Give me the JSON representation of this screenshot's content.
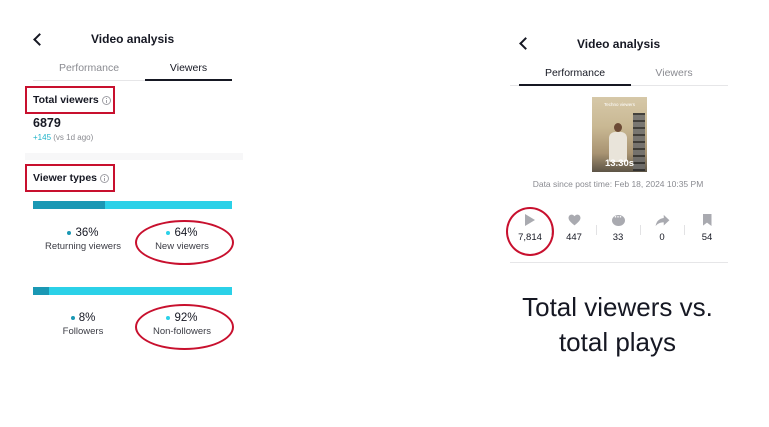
{
  "left": {
    "header": {
      "title": "Video analysis"
    },
    "tabs": [
      {
        "label": "Performance",
        "active": false
      },
      {
        "label": "Viewers",
        "active": true
      }
    ],
    "total_viewers": {
      "label": "Total viewers",
      "value": "6879",
      "delta": "+145",
      "delta_suffix": "(vs 1d ago)"
    },
    "viewer_types": {
      "label": "Viewer types",
      "split1": {
        "left_pct": "36%",
        "left_label": "Returning viewers",
        "right_pct": "64%",
        "right_label": "New viewers",
        "left_fraction": 0.36
      },
      "split2": {
        "left_pct": "8%",
        "left_label": "Followers",
        "right_pct": "92%",
        "right_label": "Non-followers",
        "left_fraction": 0.08
      }
    }
  },
  "right": {
    "header": {
      "title": "Video analysis"
    },
    "tabs": [
      {
        "label": "Performance",
        "active": true
      },
      {
        "label": "Viewers",
        "active": false
      }
    ],
    "thumbnail": {
      "caption": "Techno viewers",
      "duration": "13.30s"
    },
    "meta": "Data since post time: Feb 18, 2024 10:35 PM",
    "metrics": [
      {
        "icon": "play-icon",
        "value": "7,814"
      },
      {
        "icon": "heart-icon",
        "value": "447"
      },
      {
        "icon": "comment-icon",
        "value": "33"
      },
      {
        "icon": "share-icon",
        "value": "0"
      },
      {
        "icon": "bookmark-icon",
        "value": "54"
      }
    ]
  },
  "annotation": {
    "line1": "Total viewers vs.",
    "line2": "total plays"
  },
  "colors": {
    "annotation_red": "#c8102e",
    "bar_dark": "#1a98b4",
    "bar_light": "#2bd1e8",
    "accent_teal": "#20b3c9"
  }
}
